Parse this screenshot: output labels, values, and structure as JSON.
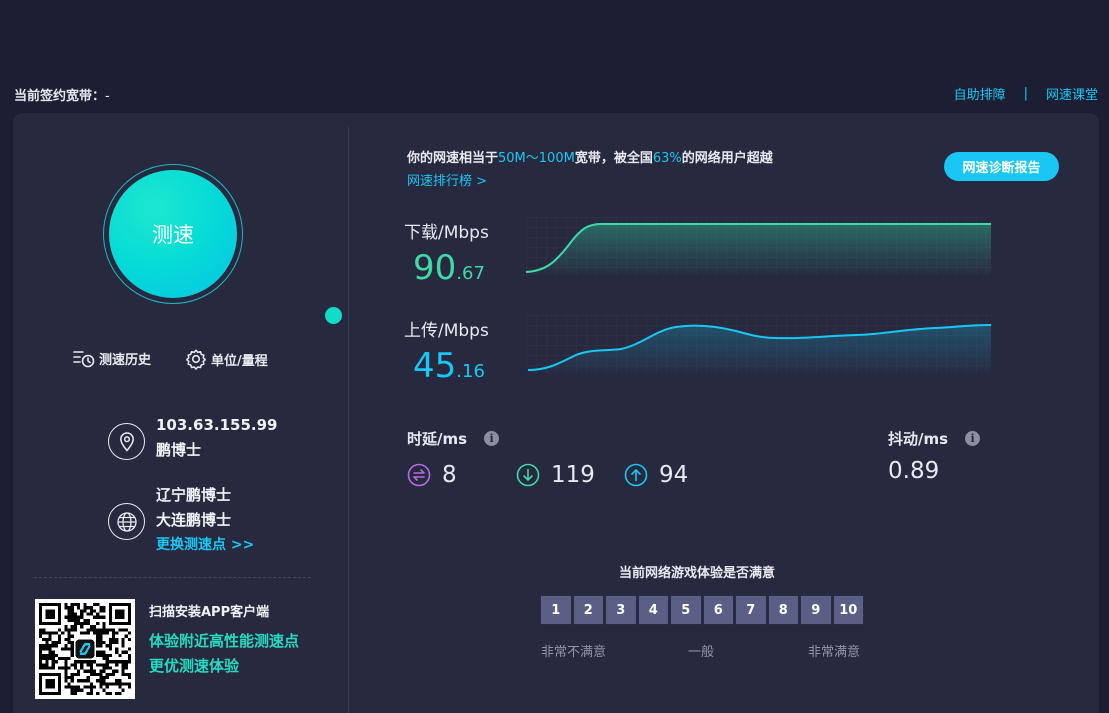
{
  "header": {
    "contract_label": "当前签约宽带：",
    "contract_value": "-",
    "link_self_fix": "自助排障",
    "link_separator": "|",
    "link_class": "网速课堂"
  },
  "left": {
    "speed_button": "测速",
    "history_label": "测速历史",
    "unit_label": "单位/量程",
    "ip": "103.63.155.99",
    "isp": "鹏博士",
    "server_region": "辽宁鹏博士",
    "server_city": "大连鹏博士",
    "change_server": "更换测速点 >>",
    "app_title": "扫描安装APP客户端",
    "app_line1": "体验附近高性能测速点",
    "app_line2": "更优测速体验"
  },
  "summary": {
    "prefix": "你的网速相当于",
    "bandwidth": "50M～100M",
    "mid": "宽带，被全国",
    "percent": "63%",
    "suffix": "的网络用户超越",
    "rank_link": "网速排行榜 >",
    "report_button": "网速诊断报告"
  },
  "download": {
    "label": "下载/Mbps",
    "int": "90",
    "dec": ".67"
  },
  "upload": {
    "label": "上传/Mbps",
    "int": "45",
    "dec": ".16"
  },
  "latency": {
    "label": "时延/ms",
    "ping": "8",
    "down": "119",
    "up": "94"
  },
  "jitter": {
    "label": "抖动/ms",
    "value": "0.89"
  },
  "rating": {
    "title": "当前网络游戏体验是否满意",
    "scores": [
      "1",
      "2",
      "3",
      "4",
      "5",
      "6",
      "7",
      "8",
      "9",
      "10"
    ],
    "low": "非常不满意",
    "mid": "一般",
    "high": "非常满意"
  },
  "colors": {
    "accent_cyan": "#19c7f4",
    "accent_green": "#3fd9a6",
    "ping_purple": "#b56ee0",
    "panel": "#27293f",
    "background": "#1c1f33"
  },
  "icons": {
    "history": "history-icon",
    "unit": "gear-icon",
    "ip": "location-pin-icon",
    "isp": "globe-icon",
    "ping": "swap-icon",
    "down": "arrow-down-circle-icon",
    "up": "arrow-up-circle-icon",
    "info": "info-icon"
  }
}
